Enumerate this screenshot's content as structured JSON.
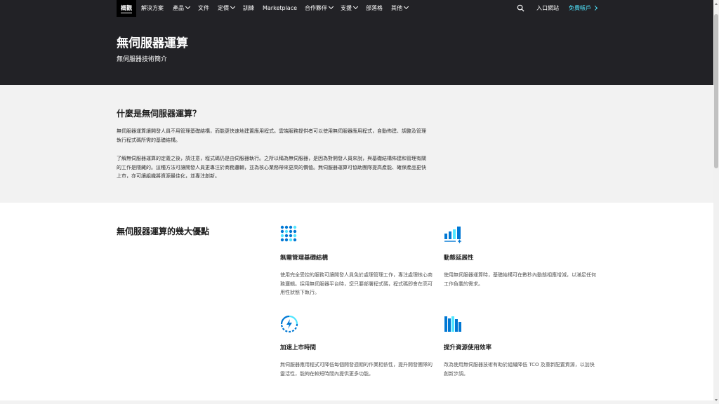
{
  "nav": {
    "items": [
      {
        "label": "概觀"
      },
      {
        "label": "解決方案"
      },
      {
        "label": "產品"
      },
      {
        "label": "文件"
      },
      {
        "label": "定價"
      },
      {
        "label": "訓練"
      },
      {
        "label": "Marketplace"
      },
      {
        "label": "合作夥伴"
      },
      {
        "label": "支援"
      },
      {
        "label": "部落格"
      },
      {
        "label": "其他"
      }
    ],
    "portal_label": "入口網站",
    "free_account_label": "免費帳戶",
    "search_icon": "search-icon"
  },
  "hero": {
    "title": "無伺服器運算",
    "subtitle": "無伺服器技術簡介"
  },
  "what_is": {
    "heading": "什麼是無伺服器運算？",
    "p1": "無伺服器運算讓開發人員不用管理基礎結構，而能更快速地建置應用程式。雲端服務提供者可以使用無伺服器應用程式，自動佈建、調整及管理執行程式碼所需的基礎結構。",
    "p2": "了解無伺服器運算的定義之後，請注意，程式碼仍是由伺服器執行。之所以稱為無伺服器，是因為對開發人員來說，與基礎結構佈建和管理有關的工作是隱藏的。這種方法可讓開發人員更專注於商務邏輯，並為核心業務帶來更高的價值。無伺服器運算可協助團隊提高產能、確保產品更快上市，亦可讓組織將資源最佳化，並專注創新。"
  },
  "benefits": {
    "heading": "無伺服器運算的幾大優點",
    "items": [
      {
        "icon": "grid-dots-icon",
        "title": "無需管理基礎結構",
        "text": "使用完全受控的服務可讓開發人員免於處理管理工作，專注處理核心商務邏輯。採用無伺服器平台時，您只要部署程式碼，程式碼即會在高可用性狀態下執行。"
      },
      {
        "icon": "scaling-bars-icon",
        "title": "動態延展性",
        "text": "使用無伺服器運算時，基礎結構可在數秒內動態相應增減，以滿足任何工作負載的需求。"
      },
      {
        "icon": "lightning-icon",
        "title": "加速上市時間",
        "text": "無伺服器應用程式可降低每個開發週期的作業相依性，提升開發團隊的靈活性，能夠在較短時間內提供更多功能。"
      },
      {
        "icon": "books-icon",
        "title": "提升資源使用效率",
        "text": "改為使用無伺服器技術有助於組織降低 TCO 及重新配置資源，以加快創新步調。"
      }
    ]
  },
  "colors": {
    "dark_bg": "#222226",
    "accent": "#0078d4",
    "accent_light": "#50e6ff",
    "gray_section": "#f2f2f2"
  }
}
